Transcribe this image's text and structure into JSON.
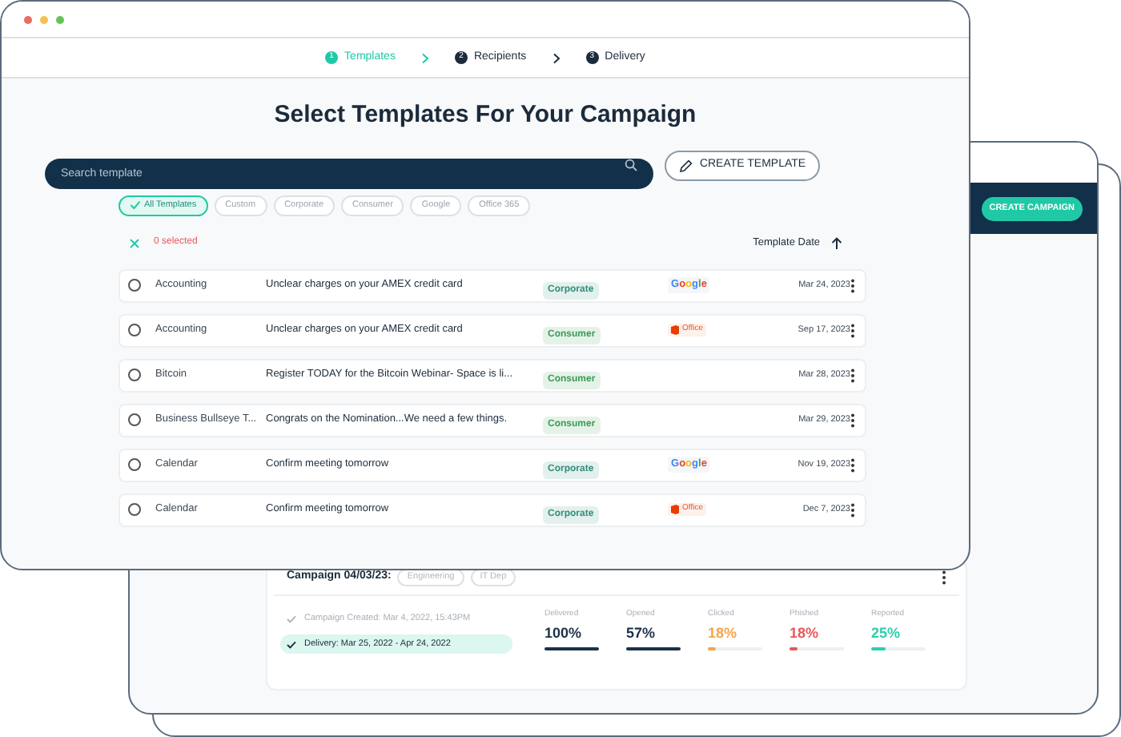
{
  "steps": [
    {
      "number": "1",
      "label": "Templates",
      "selected": true
    },
    {
      "number": "2",
      "label": "Recipients",
      "selected": false
    },
    {
      "number": "3",
      "label": "Delivery",
      "selected": false
    }
  ],
  "heading": "Select Templates For Your Campaign",
  "search": {
    "placeholder": "Search template"
  },
  "create_template_button": "CREATE TEMPLATE",
  "filters": [
    {
      "label": "All Templates",
      "selected": true
    },
    {
      "label": "Custom",
      "selected": false
    },
    {
      "label": "Corporate",
      "selected": false
    },
    {
      "label": "Consumer",
      "selected": false
    },
    {
      "label": "Google",
      "selected": false
    },
    {
      "label": "Office 365",
      "selected": false
    }
  ],
  "selection_count": "0 selected",
  "sort": {
    "label": "Template Date"
  },
  "templates": [
    {
      "name": "Accounting",
      "subject": "Unclear charges on your AMEX credit card",
      "tag": {
        "label": "Corporate",
        "color": "#2f8f7b"
      },
      "provider": {
        "kind": "google",
        "label": "Google"
      },
      "date": "Mar 24, 2023",
      "selected": false
    },
    {
      "name": "Accounting",
      "subject": "Unclear charges on your AMEX credit card",
      "tag": {
        "label": "Consumer",
        "color": "#3a9a55"
      },
      "provider": {
        "kind": "office",
        "label": "Office"
      },
      "date": "Sep 17, 2023",
      "selected": false
    },
    {
      "name": "Bitcoin",
      "subject": "Register TODAY for the Bitcoin Webinar- Space is li...",
      "tag": {
        "label": "Consumer",
        "color": "#3a9a55"
      },
      "date": "Mar 28, 2023",
      "selected": false
    },
    {
      "name": "Business Bullseye T...",
      "subject": "Congrats on the Nomination...We need a few things.",
      "tag": {
        "label": "Consumer",
        "color": "#3a9a55"
      },
      "date": "Mar 29, 2023",
      "selected": false
    },
    {
      "name": "Calendar",
      "subject": "Confirm meeting tomorrow",
      "tag": {
        "label": "Corporate",
        "color": "#2f8f7b"
      },
      "provider": {
        "kind": "google",
        "label": "Google"
      },
      "date": "Nov 19, 2023",
      "selected": false
    },
    {
      "name": "Calendar",
      "subject": "Confirm meeting tomorrow",
      "tag": {
        "label": "Corporate",
        "color": "#2f8f7b"
      },
      "provider": {
        "kind": "office",
        "label": "Office"
      },
      "date": "Dec 7, 2023",
      "selected": false
    }
  ],
  "back_window": {
    "create_campaign_button": "CREATE CAMPAIGN",
    "campaign": {
      "title": "Campaign 04/03/23:",
      "tags": [
        "Engineering",
        "IT Dep"
      ],
      "timeline": [
        {
          "label": "Campaign Created:",
          "value": "Mar 4, 2022, 15:43PM",
          "selected": false
        },
        {
          "label": "Delivery:",
          "value": "Mar 25, 2022 - Apr 24, 2022",
          "selected": true
        }
      ],
      "metrics": [
        {
          "label": "Delivered",
          "value": "100%",
          "level": 1,
          "color": "#1b3148"
        },
        {
          "label": "Opened",
          "value": "57%",
          "level": 1,
          "color": "#1b3148"
        },
        {
          "label": "Clicked",
          "value": "18%",
          "level": 0.15,
          "color": "#f5a54a"
        },
        {
          "label": "Phished",
          "value": "18%",
          "level": 0.15,
          "color": "#e8575a"
        },
        {
          "label": "Reported",
          "value": "25%",
          "level": 0.25,
          "color": "#2ccfae"
        }
      ]
    }
  }
}
